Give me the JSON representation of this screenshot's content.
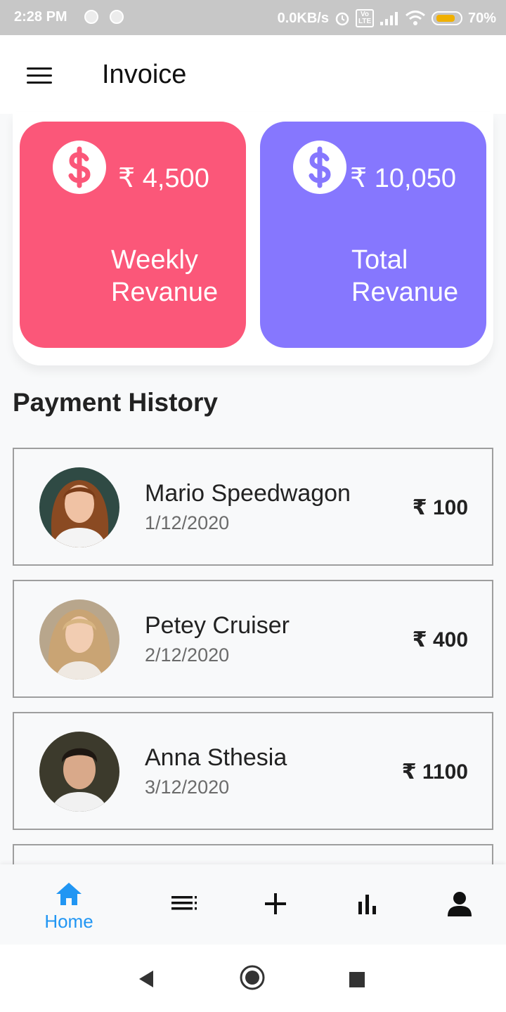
{
  "status_bar": {
    "time": "2:28 PM",
    "speed": "0.0KB/s",
    "volte": "Vo LTE",
    "battery": "70%"
  },
  "app_bar": {
    "title": "Invoice",
    "menu_icon": "menu-icon"
  },
  "revenue_cards": [
    {
      "amount": "₹ 4,500",
      "label_line1": "Weekly",
      "label_line2": "Revanue",
      "color": "#fb5779",
      "icon": "dollar-icon"
    },
    {
      "amount": "₹ 10,050",
      "label_line1": "Total",
      "label_line2": "Revanue",
      "color": "#8677fe",
      "icon": "dollar-icon"
    }
  ],
  "payment_history": {
    "title": "Payment History",
    "items": [
      {
        "name": "Mario Speedwagon",
        "date": "1/12/2020",
        "amount": "₹ 100"
      },
      {
        "name": "Petey Cruiser",
        "date": "2/12/2020",
        "amount": "₹ 400"
      },
      {
        "name": "Anna Sthesia",
        "date": "3/12/2020",
        "amount": "₹ 1100"
      }
    ]
  },
  "bottom_nav": {
    "active_color": "#2196f3",
    "items": [
      {
        "icon": "home-icon",
        "label": "Home",
        "active": true
      },
      {
        "icon": "list-icon",
        "label": ""
      },
      {
        "icon": "plus-icon",
        "label": ""
      },
      {
        "icon": "bar-chart-icon",
        "label": ""
      },
      {
        "icon": "person-icon",
        "label": ""
      }
    ]
  },
  "system_nav": {
    "icons": [
      "back-icon",
      "home-circle-icon",
      "recents-icon"
    ]
  }
}
